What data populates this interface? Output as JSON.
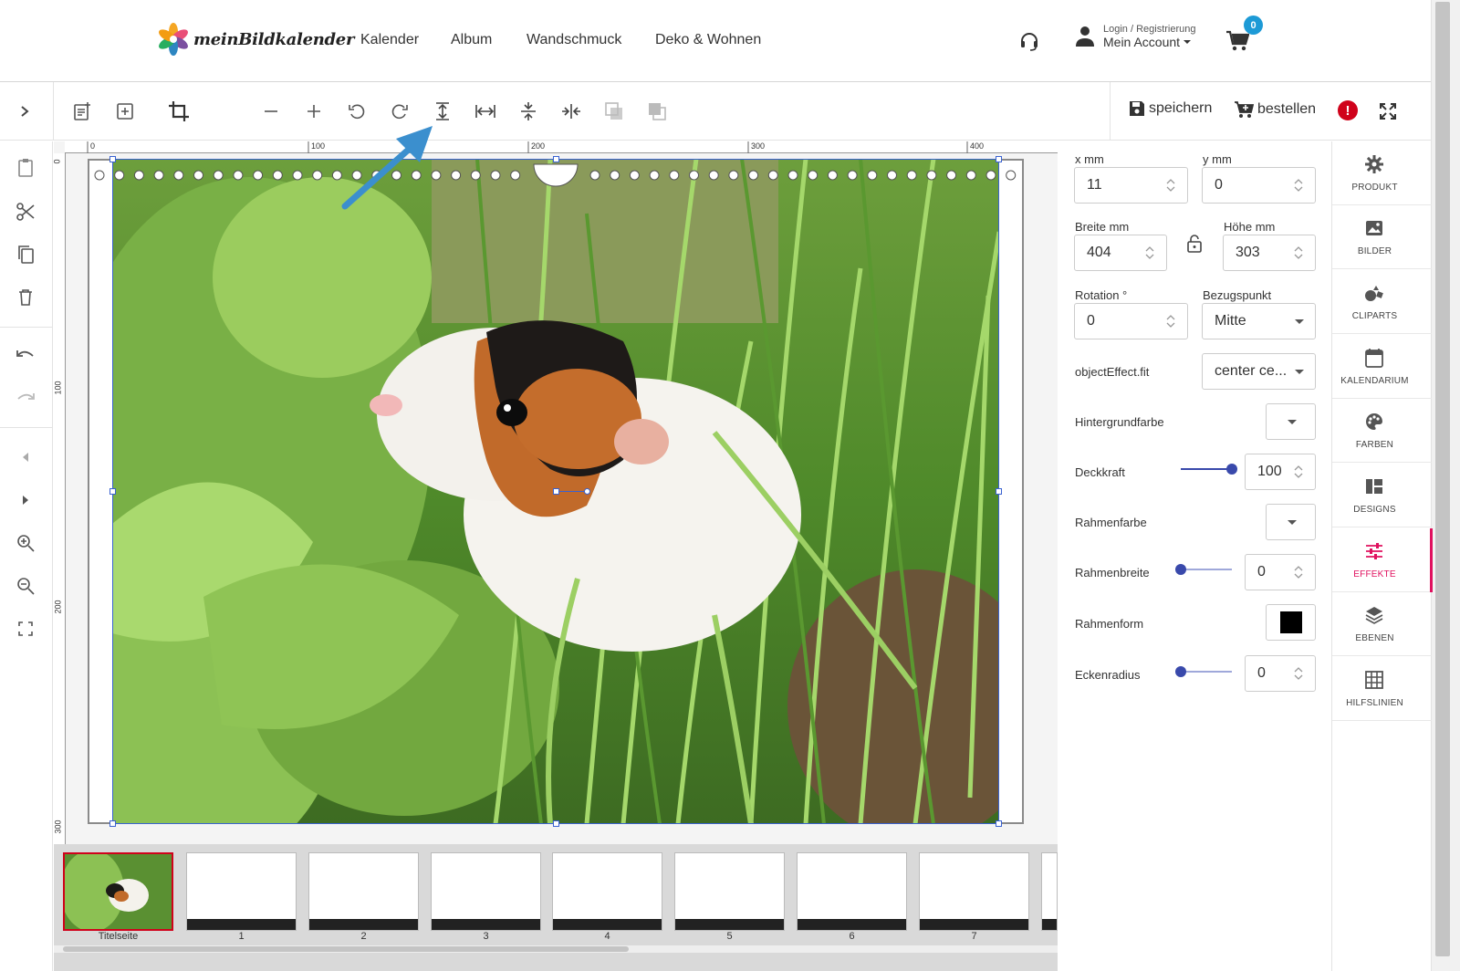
{
  "header": {
    "logo_text": "meinBildkalender",
    "nav": [
      "Kalender",
      "Album",
      "Wandschmuck",
      "Deko & Wohnen"
    ],
    "account_small": "Login / Registrierung",
    "account_main": "Mein Account",
    "cart_count": "0",
    "icons": [
      "headset-icon",
      "user-icon",
      "cart-icon"
    ]
  },
  "toolbar": {
    "save_label": "speichern",
    "order_label": "bestellen",
    "icons": [
      "collapse-toggle-icon",
      "new-document-icon",
      "add-frame-icon",
      "crop-icon",
      "toggle-switch",
      "zoom-out-minus-icon",
      "zoom-in-plus-icon",
      "rotate-left-icon",
      "rotate-right-icon",
      "fit-height-icon",
      "fit-width-icon",
      "center-vertical-icon",
      "center-horizontal-icon",
      "send-backward-icon",
      "bring-forward-icon",
      "save-icon",
      "cart-plus-icon",
      "warning-icon",
      "fullscreen-icon"
    ]
  },
  "leftbar": {
    "icons": [
      "clipboard-icon",
      "scissors-icon",
      "copy-icon",
      "delete-icon",
      "undo-icon",
      "redo-icon",
      "previous-icon",
      "next-icon",
      "zoom-in-icon",
      "zoom-out-icon",
      "fit-screen-icon"
    ]
  },
  "ruler": {
    "top": [
      "0",
      "100",
      "200",
      "300",
      "400"
    ],
    "left": [
      "0",
      "100",
      "200",
      "300"
    ]
  },
  "filmstrip": {
    "pages": [
      "Titelseite",
      "1",
      "2",
      "3",
      "4",
      "5",
      "6",
      "7"
    ],
    "selected": "Titelseite"
  },
  "props": {
    "x_label": "x mm",
    "x_value": "11",
    "y_label": "y mm",
    "y_value": "0",
    "width_label": "Breite mm",
    "width_value": "404",
    "height_label": "Höhe mm",
    "height_value": "303",
    "rotation_label": "Rotation °",
    "rotation_value": "0",
    "anchor_label": "Bezugspunkt",
    "anchor_value": "Mitte",
    "fit_label": "objectEffect.fit",
    "fit_value": "center ce...",
    "bg_label": "Hintergrundfarbe",
    "opacity_label": "Deckkraft",
    "opacity_value": "100",
    "opacity_fraction": 1.0,
    "border_color_label": "Rahmenfarbe",
    "border_width_label": "Rahmenbreite",
    "border_width_value": "0",
    "border_width_fraction": 0,
    "border_shape_label": "Rahmenform",
    "corner_radius_label": "Eckenradius",
    "corner_radius_value": "0",
    "corner_radius_fraction": 0
  },
  "tabs": [
    {
      "label": "PRODUKT",
      "icon": "gear-icon"
    },
    {
      "label": "BILDER",
      "icon": "image-icon"
    },
    {
      "label": "CLIPARTS",
      "icon": "cliparts-icon"
    },
    {
      "label": "KALENDARIUM",
      "icon": "calendar-icon"
    },
    {
      "label": "FARBEN",
      "icon": "palette-icon"
    },
    {
      "label": "DESIGNS",
      "icon": "designs-icon"
    },
    {
      "label": "EFFEKTE",
      "icon": "sliders-icon",
      "active": true
    },
    {
      "label": "EBENEN",
      "icon": "layers-icon"
    },
    {
      "label": "HILFSLINIEN",
      "icon": "grid-icon"
    }
  ],
  "colors": {
    "accent": "#e0115f",
    "slider": "#3949ab",
    "badge": "#1d9ad6",
    "warning": "#d0021b",
    "selection": "#3a62d1"
  }
}
